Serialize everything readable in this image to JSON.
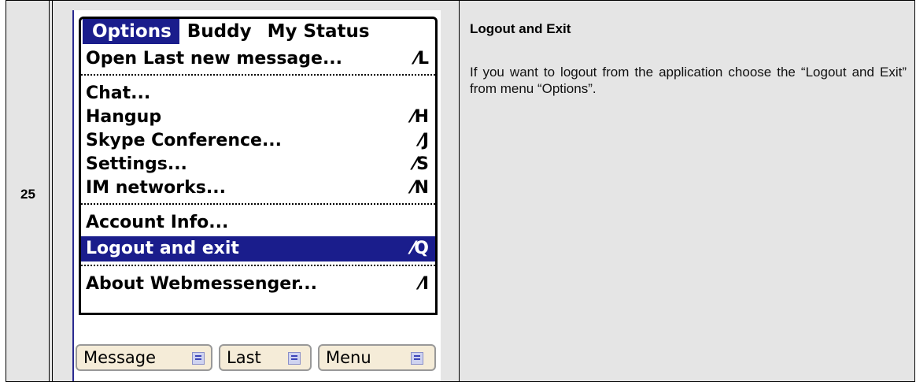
{
  "row": {
    "number": "25"
  },
  "palm": {
    "menubar": [
      {
        "label": "Options",
        "active": true
      },
      {
        "label": "Buddy",
        "active": false
      },
      {
        "label": "My Status",
        "active": false
      }
    ],
    "menu_items": [
      {
        "label": "Open Last new message...",
        "shortcut": "⁄L"
      },
      {
        "label": "Chat...",
        "shortcut": ""
      },
      {
        "label": "Hangup",
        "shortcut": "⁄H"
      },
      {
        "label": "Skype Conference...",
        "shortcut": "⁄J"
      },
      {
        "label": "Settings...",
        "shortcut": "⁄S"
      },
      {
        "label": "IM networks...",
        "shortcut": "⁄N"
      },
      {
        "label": "Account Info...",
        "shortcut": ""
      },
      {
        "label": "Logout and exit",
        "shortcut": "⁄Q",
        "selected": true
      },
      {
        "label": "About Webmessenger...",
        "shortcut": "⁄I"
      }
    ],
    "buttons": [
      {
        "label": "Message"
      },
      {
        "label": "Last"
      },
      {
        "label": "Menu"
      }
    ],
    "colors": {
      "highlight": "#1a1d8c",
      "button_bg": "#f5ecd8"
    }
  },
  "description": {
    "title": "Logout and Exit",
    "text": "If you want to logout from the application choose the “Logout and Exit” from menu “Options”."
  }
}
